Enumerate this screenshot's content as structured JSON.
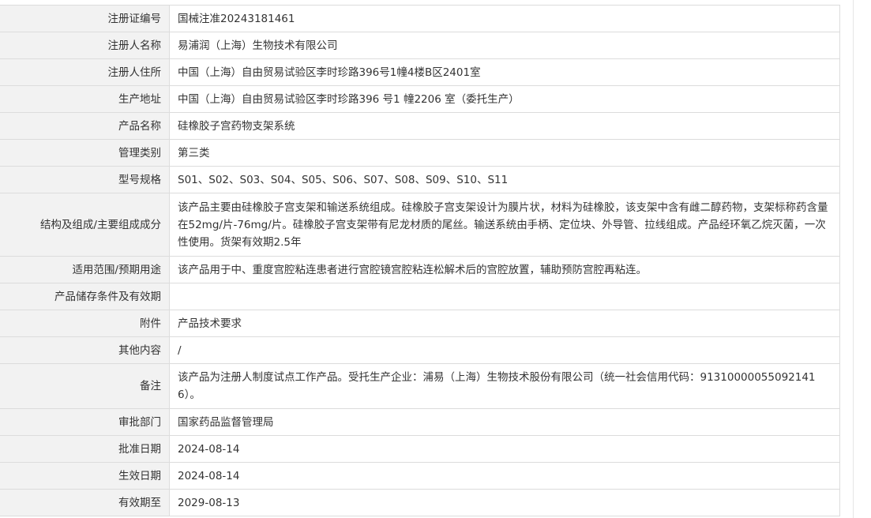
{
  "rows": [
    {
      "label": "注册证编号",
      "value": "国械注准20243181461"
    },
    {
      "label": "注册人名称",
      "value": "易浦润（上海）生物技术有限公司"
    },
    {
      "label": "注册人住所",
      "value": "中国（上海）自由贸易试验区李时珍路396号1幢4楼B区2401室"
    },
    {
      "label": "生产地址",
      "value": "中国（上海）自由贸易试验区李时珍路396 号1 幢2206 室（委托生产）"
    },
    {
      "label": "产品名称",
      "value": "硅橡胶子宫药物支架系统"
    },
    {
      "label": "管理类别",
      "value": "第三类"
    },
    {
      "label": "型号规格",
      "value": "S01、S02、S03、S04、S05、S06、S07、S08、S09、S10、S11"
    },
    {
      "label": "结构及组成/主要组成成分",
      "value": "该产品主要由硅橡胶子宫支架和输送系统组成。硅橡胶子宫支架设计为膜片状，材料为硅橡胶，该支架中含有雌二醇药物，支架标称药含量在52mg/片-76mg/片。硅橡胶子宫支架带有尼龙材质的尾丝。输送系统由手柄、定位块、外导管、拉线组成。产品经环氧乙烷灭菌，一次性使用。货架有效期2.5年"
    },
    {
      "label": "适用范围/预期用途",
      "value": "该产品用于中、重度宫腔粘连患者进行宫腔镜宫腔粘连松解术后的宫腔放置，辅助预防宫腔再粘连。"
    },
    {
      "label": "产品储存条件及有效期",
      "value": ""
    },
    {
      "label": "附件",
      "value": "产品技术要求"
    },
    {
      "label": "其他内容",
      "value": "/"
    },
    {
      "label": "备注",
      "value": "该产品为注册人制度试点工作产品。受托生产企业：浦易（上海）生物技术股份有限公司（统一社会信用代码：913100000550921416）。"
    },
    {
      "label": "审批部门",
      "value": "国家药品监督管理局"
    },
    {
      "label": "批准日期",
      "value": "2024-08-14"
    },
    {
      "label": "生效日期",
      "value": "2024-08-14"
    },
    {
      "label": "有效期至",
      "value": "2029-08-13"
    }
  ]
}
